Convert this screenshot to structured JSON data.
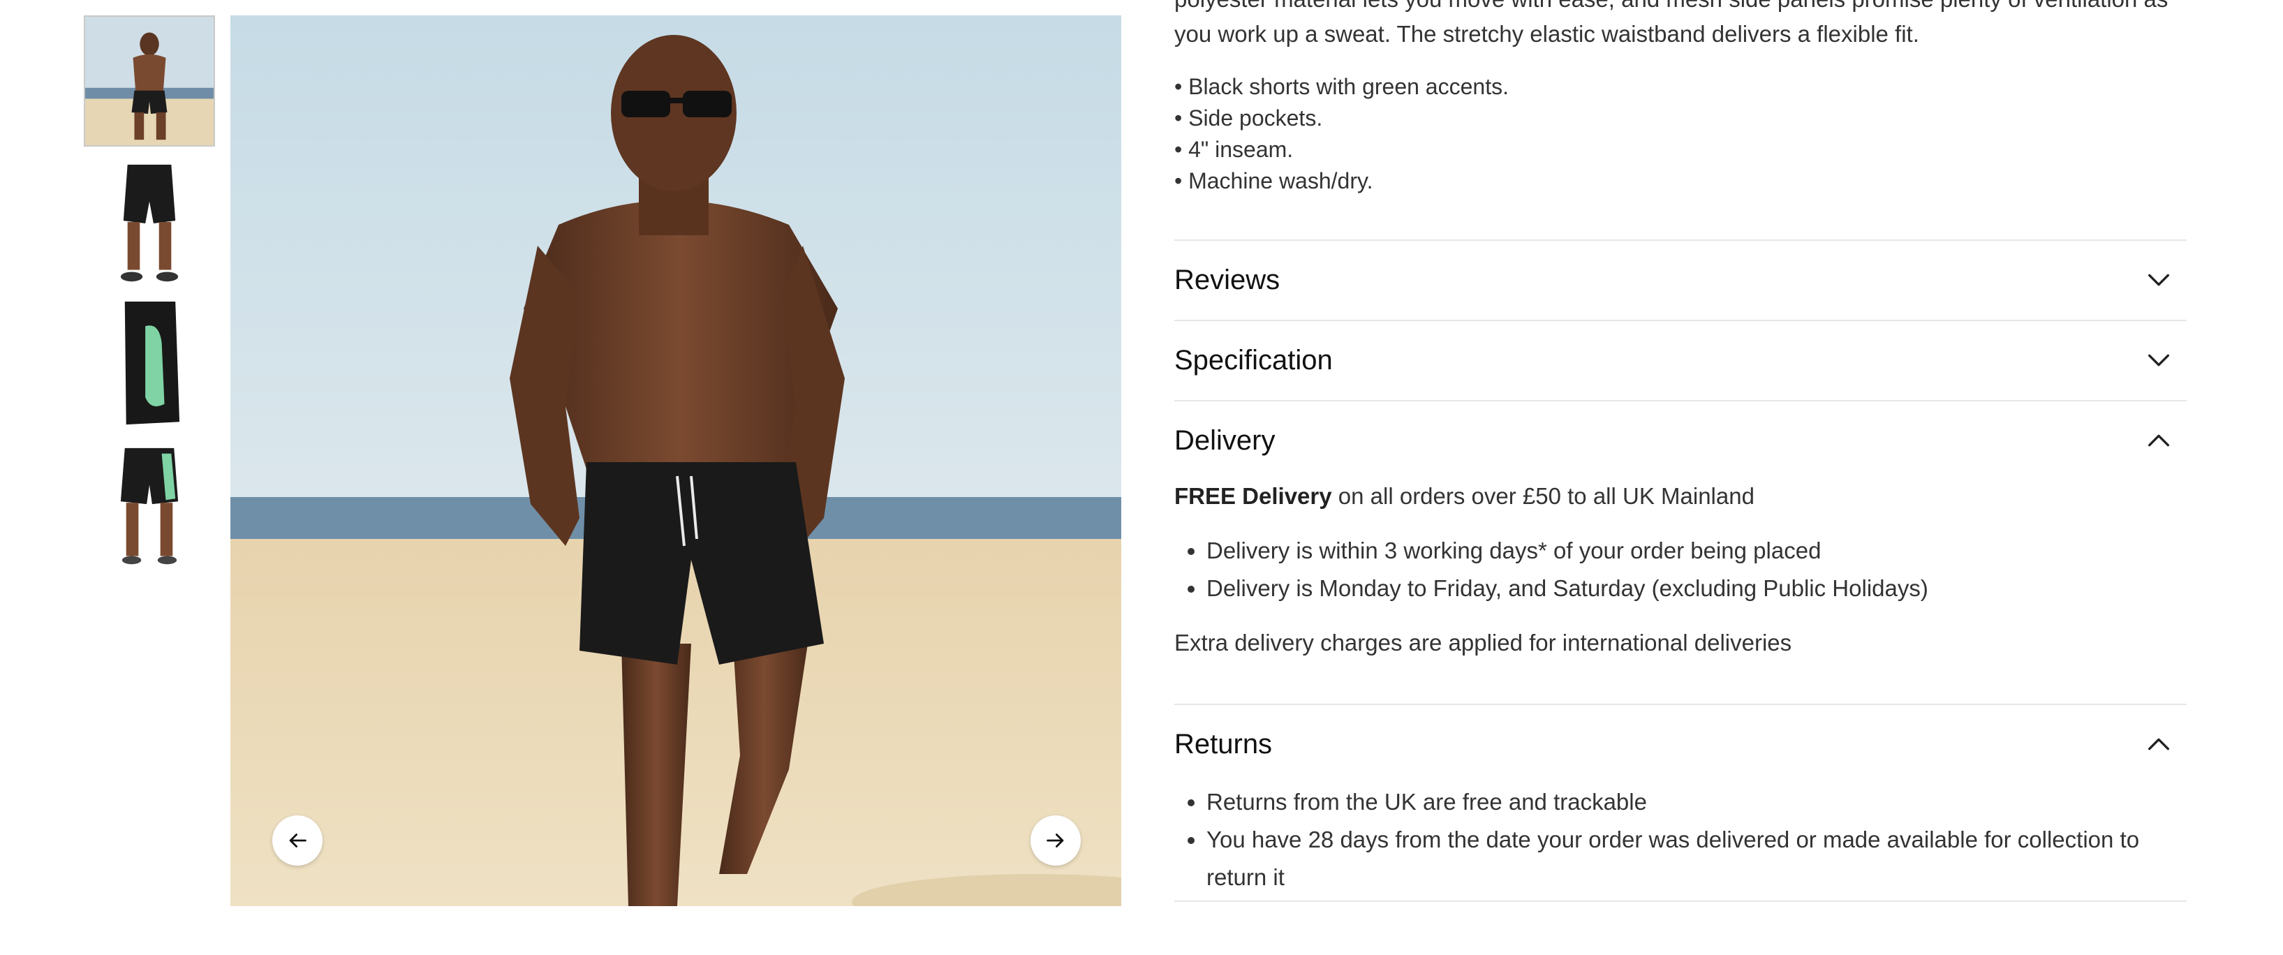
{
  "gallery": {
    "thumbnails": [
      {
        "alt": "model-on-beach"
      },
      {
        "alt": "front-view"
      },
      {
        "alt": "side-view-green-panel"
      },
      {
        "alt": "back-view"
      }
    ],
    "prev_icon": "arrow-left-icon",
    "next_icon": "arrow-right-icon"
  },
  "product": {
    "description_tail": "polyester material lets you move with ease, and mesh side panels promise plenty of ventilation as you work up a sweat. The stretchy elastic waistband delivers a flexible fit.",
    "features": [
      "• Black shorts with green accents.",
      "• Side pockets.",
      "• 4\" inseam.",
      "• Machine wash/dry."
    ]
  },
  "accordions": {
    "reviews": {
      "title": "Reviews",
      "state": "collapsed",
      "icon": "chevron-down-icon"
    },
    "specification": {
      "title": "Specification",
      "state": "collapsed",
      "icon": "chevron-down-icon"
    },
    "delivery": {
      "title": "Delivery",
      "state": "expanded",
      "icon": "chevron-up-icon",
      "free_bold": "FREE Delivery",
      "free_rest": " on all orders over £50 to all UK Mainland",
      "items": [
        "Delivery is within 3 working days* of your order being placed",
        "Delivery is Monday to Friday, and Saturday (excluding Public Holidays)"
      ],
      "extra": "Extra delivery charges are applied for international deliveries"
    },
    "returns": {
      "title": "Returns",
      "state": "expanded",
      "icon": "chevron-up-icon",
      "items": [
        "Returns from the UK are free and trackable",
        "You have 28 days from the date your order was delivered or made available for collection to return it"
      ]
    }
  },
  "colors": {
    "text": "#222222",
    "divider": "#e6e6e6",
    "shorts_black": "#1a1a1a",
    "accent_green": "#7fd3a4"
  }
}
